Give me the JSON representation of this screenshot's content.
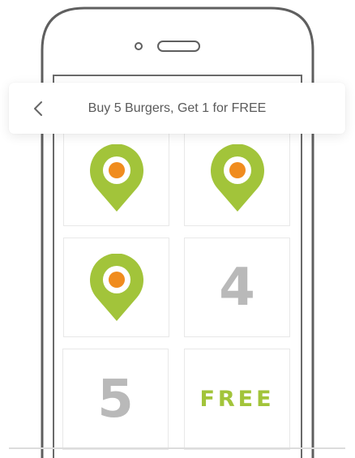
{
  "header": {
    "title": "Buy 5 Burgers, Get 1 for FREE",
    "back_icon": "chevron-left-icon"
  },
  "stamp_card": {
    "tiles": [
      {
        "kind": "stamp",
        "icon": "location-pin-icon"
      },
      {
        "kind": "stamp",
        "icon": "location-pin-icon"
      },
      {
        "kind": "stamp",
        "icon": "location-pin-icon"
      },
      {
        "kind": "number",
        "label": "4"
      },
      {
        "kind": "number",
        "label": "5"
      },
      {
        "kind": "reward",
        "label": "FREE"
      }
    ]
  },
  "colors": {
    "pin_green": "#a2c43a",
    "pin_dot_orange": "#f08c1e",
    "number_gray": "#b9b9b9",
    "free_green": "#a2c43a",
    "phone_outline": "#5f5f5f",
    "title_text": "#5a5a5a"
  }
}
